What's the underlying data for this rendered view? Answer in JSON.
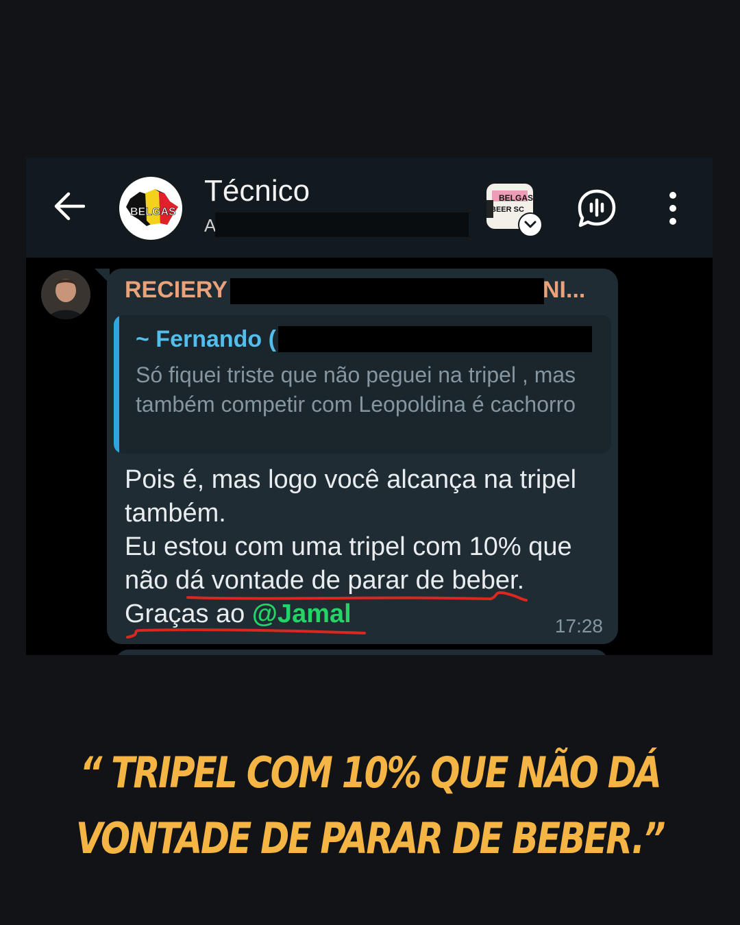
{
  "header": {
    "back_icon": "arrow-left-icon",
    "group_name": "Técnico",
    "group_subtitle": "A",
    "avatar_text": "BELGAS",
    "community_text_line1": "BELGAS",
    "community_text_line2": "BEER SC",
    "voice_icon": "voice-chat-icon",
    "menu_icon": "more-vertical-icon"
  },
  "message": {
    "sender_name": "RECIERY",
    "sender_name_tail": "NI...",
    "quote_author": "~ Fernando (",
    "quote_text": "Só fiquei triste que não peguei na tripel , mas também competir com Leopoldina é cachorro",
    "text_line1": "Pois é, mas logo você alcança na tripel também.",
    "text_line2": "Eu estou com uma tripel com 10% que não dá vontade de parar de beber. Graças ao ",
    "mention": "@Jamal",
    "time": "17:28"
  },
  "caption": {
    "text": "“ TRIPEL COM 10% QUE NÃO DÁ VONTADE DE PARAR DE BEBER.”"
  },
  "colors": {
    "background": "#111317",
    "bubble": "#1f2c34",
    "sender": "#e9a27a",
    "quote_author": "#53bdeb",
    "mention": "#25d366",
    "underline": "#d9281f",
    "caption": "#f5b545"
  }
}
